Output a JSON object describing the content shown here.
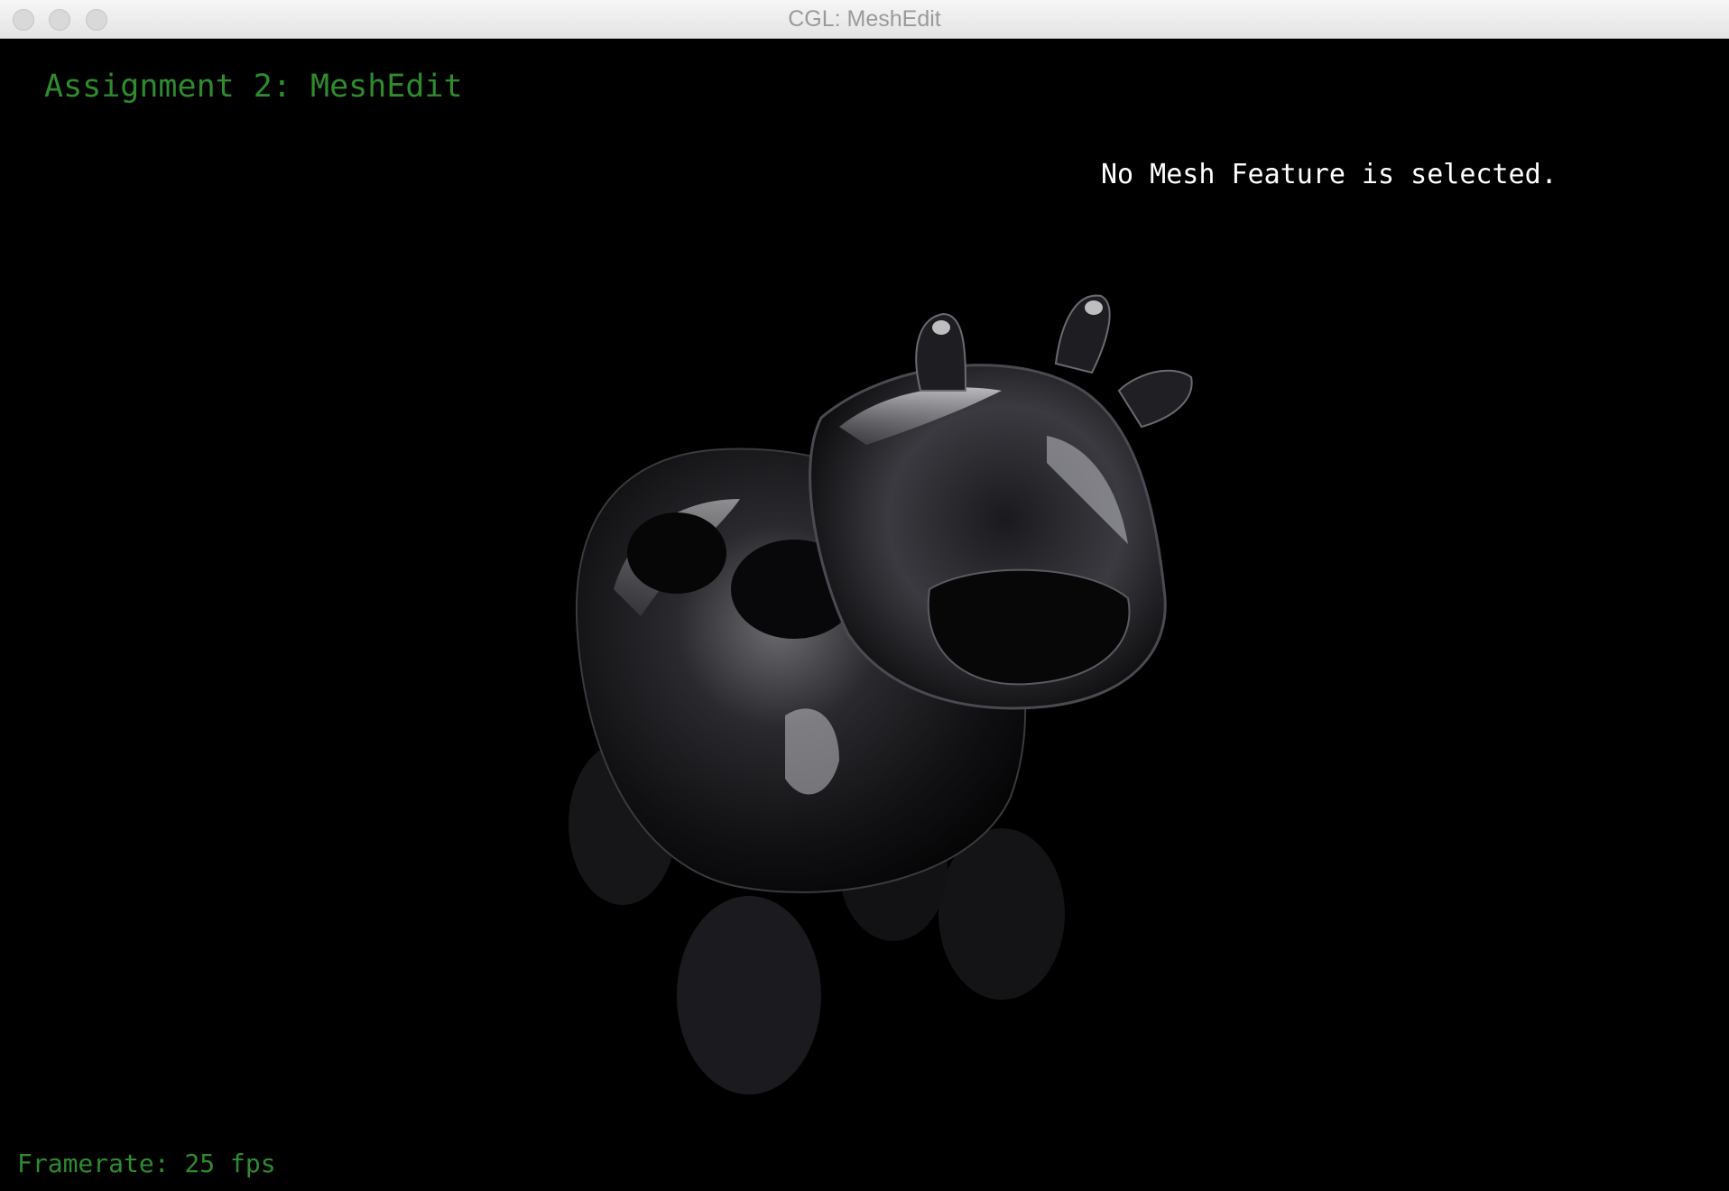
{
  "window": {
    "title": "CGL: MeshEdit"
  },
  "overlay": {
    "assignment_title": "Assignment 2: MeshEdit",
    "selection_status": "No Mesh Feature is selected.",
    "framerate": "Framerate: 25 fps"
  },
  "colors": {
    "accent_green": "#2e8b2e",
    "text_white": "#ffffff",
    "background": "#000000"
  }
}
